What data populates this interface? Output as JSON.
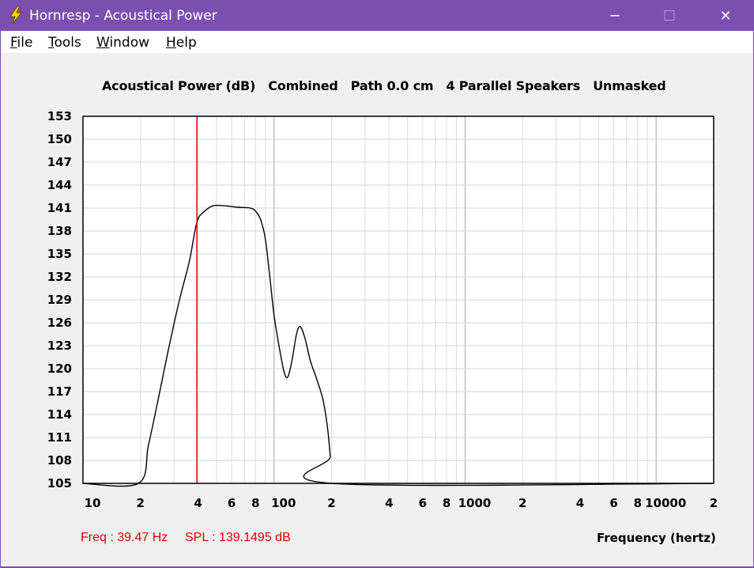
{
  "window": {
    "title": "Hornresp - Acoustical Power",
    "controls": {
      "minimize": "─",
      "maximize": "☐",
      "close": "✕"
    }
  },
  "menu": [
    {
      "label_u": "F",
      "label_rest": "ile"
    },
    {
      "label_u": "T",
      "label_rest": "ools"
    },
    {
      "label_u": "W",
      "label_rest": "indow"
    },
    {
      "label_u": "H",
      "label_rest": "elp"
    }
  ],
  "chart_title": "Acoustical Power (dB)   Combined   Path 0.0 cm   4 Parallel Speakers   Unmasked",
  "readout": {
    "freq": "Freq : 39.47 Hz",
    "spl": "SPL : 139.1495 dB",
    "color": "#e00000"
  },
  "xaxis_title": "Frequency (hertz)",
  "chart_data": {
    "type": "line",
    "title": "Acoustical Power (dB)   Combined   Path 0.0 cm   4 Parallel Speakers   Unmasked",
    "xlabel": "Frequency (hertz)",
    "ylabel": "",
    "xscale": "log",
    "xlim": [
      10,
      20000
    ],
    "ylim": [
      105,
      153
    ],
    "grid": true,
    "yticks": [
      "153",
      "150",
      "147",
      "144",
      "141",
      "138",
      "135",
      "132",
      "129",
      "126",
      "123",
      "120",
      "117",
      "114",
      "111",
      "108",
      "105"
    ],
    "xticks": [
      {
        "f": 10,
        "label": "10"
      },
      {
        "f": 20,
        "label": "2"
      },
      {
        "f": 40,
        "label": "4"
      },
      {
        "f": 60,
        "label": "6"
      },
      {
        "f": 80,
        "label": "8"
      },
      {
        "f": 100,
        "label": "100"
      },
      {
        "f": 200,
        "label": "2"
      },
      {
        "f": 400,
        "label": "4"
      },
      {
        "f": 600,
        "label": "6"
      },
      {
        "f": 800,
        "label": "8"
      },
      {
        "f": 1000,
        "label": "1000"
      },
      {
        "f": 2000,
        "label": "2"
      },
      {
        "f": 4000,
        "label": "4"
      },
      {
        "f": 6000,
        "label": "6"
      },
      {
        "f": 8000,
        "label": "8"
      },
      {
        "f": 10000,
        "label": "10000"
      },
      {
        "f": 20000,
        "label": "2"
      }
    ],
    "series": [
      {
        "line_color": "#000000",
        "points": [
          [
            10,
            105
          ],
          [
            19.5,
            105
          ],
          [
            22,
            110
          ],
          [
            25,
            116.5
          ],
          [
            28,
            122.5
          ],
          [
            32,
            129
          ],
          [
            36,
            134
          ],
          [
            39.47,
            139.1495
          ],
          [
            43,
            140.5
          ],
          [
            48,
            141.3
          ],
          [
            55,
            141.3
          ],
          [
            65,
            141.1
          ],
          [
            75,
            141.0
          ],
          [
            80,
            140.6
          ],
          [
            85,
            139.5
          ],
          [
            90,
            137.0
          ],
          [
            95,
            132.0
          ],
          [
            100,
            127.0
          ],
          [
            107,
            122.5
          ],
          [
            113,
            119.5
          ],
          [
            118,
            118.9
          ],
          [
            124,
            121.0
          ],
          [
            131,
            124.5
          ],
          [
            137,
            125.5
          ],
          [
            145,
            124.0
          ],
          [
            155,
            121.0
          ],
          [
            168,
            118.5
          ],
          [
            180,
            116.0
          ],
          [
            190,
            112.5
          ],
          [
            197,
            108.5
          ],
          [
            202,
            105
          ],
          [
            20000,
            105
          ]
        ]
      }
    ],
    "cursor": {
      "freq": 39.47,
      "spl": 139.1495,
      "color": "#ff0000"
    }
  }
}
